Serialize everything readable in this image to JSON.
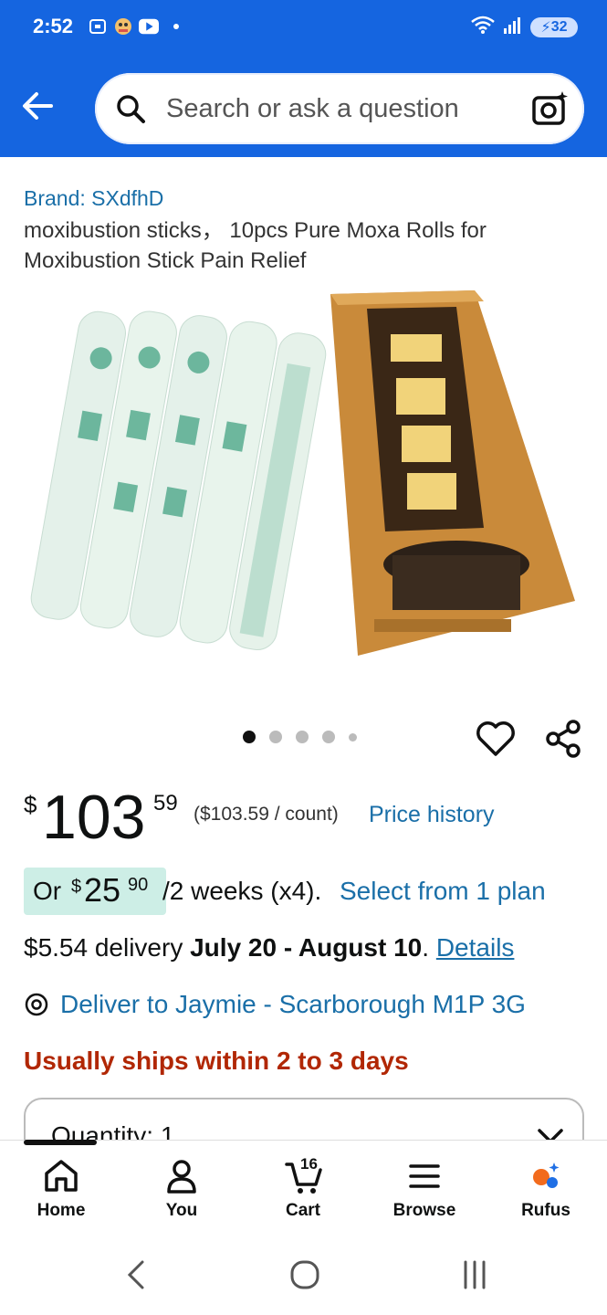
{
  "status_bar": {
    "time": "2:52",
    "battery": "32"
  },
  "search": {
    "placeholder": "Search or ask a question"
  },
  "product": {
    "brand": "Brand: SXdfhD",
    "title": "moxibustion sticks， 10pcs Pure Moxa Rolls for Moxibustion Stick Pain Relief",
    "image_count": 5,
    "active_image": 1
  },
  "price": {
    "currency": "$",
    "whole": "103",
    "fraction": "59",
    "unit_price": "($103.59 / count)",
    "price_history": "Price history"
  },
  "plan": {
    "or": "Or",
    "currency": "$",
    "whole": "25",
    "fraction": "90",
    "rest": "/2 weeks (x4).",
    "link": "Select from 1 plan"
  },
  "delivery": {
    "prefix": "$5.54 delivery ",
    "dates": "July 20 - August 10",
    "suffix": ". ",
    "details_link": "Details",
    "deliver_to": "Deliver to Jaymie - Scarborough M1P 3G"
  },
  "shipping": {
    "note": "Usually ships within 2 to 3 days"
  },
  "quantity": {
    "label": "Quantity: 1"
  },
  "bottom_nav": {
    "items": [
      {
        "label": "Home"
      },
      {
        "label": "You"
      },
      {
        "label": "Cart"
      },
      {
        "label": "Browse"
      },
      {
        "label": "Rufus"
      }
    ],
    "cart_count": "16"
  },
  "colors": {
    "brand_blue": "#1565e0",
    "link": "#1a6fa8",
    "warning": "#b12704",
    "plan_badge": "#cdeee6"
  }
}
